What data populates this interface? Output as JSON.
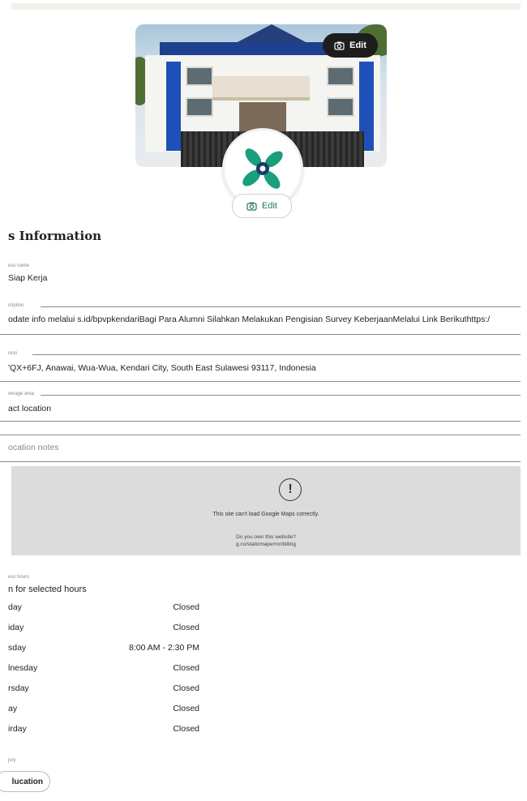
{
  "cover": {
    "edit_label": "Edit"
  },
  "avatar": {
    "edit_label": "Edit"
  },
  "section_title": "s Information",
  "fields": {
    "name": {
      "label": "ess name",
      "value": "Siap Kerja"
    },
    "description": {
      "label": "cription",
      "value": "odate info melalui s.id/bpvpkendariBagi Para Alumni Silahkan Melakukan Pengisian Survey KeberjaanMelalui Link Berikuthttps:/"
    },
    "address": {
      "label": "ress",
      "value": "'QX+6FJ, Anawai, Wua-Wua, Kendari City, South East Sulawesi 93117, Indonesia"
    },
    "coverage": {
      "label": "verage area",
      "value": "act location"
    },
    "location_notes": {
      "placeholder": "ocation notes"
    }
  },
  "map": {
    "error": "This site can't load Google Maps correctly.",
    "owner_q": "Do you own this website?",
    "owner_link": "g.co/staticmaperror/billing"
  },
  "hours": {
    "label": "ess hours",
    "value": "n for selected hours",
    "days": [
      {
        "day": "day",
        "time": "Closed"
      },
      {
        "day": "iday",
        "time": "Closed"
      },
      {
        "day": "sday",
        "time": "8:00 AM - 2:30 PM"
      },
      {
        "day": "lnesday",
        "time": "Closed"
      },
      {
        "day": "rsday",
        "time": "Closed"
      },
      {
        "day": "ay",
        "time": "Closed"
      },
      {
        "day": "irday",
        "time": "Closed"
      }
    ]
  },
  "category": {
    "label": "jory",
    "value": "lucation"
  }
}
